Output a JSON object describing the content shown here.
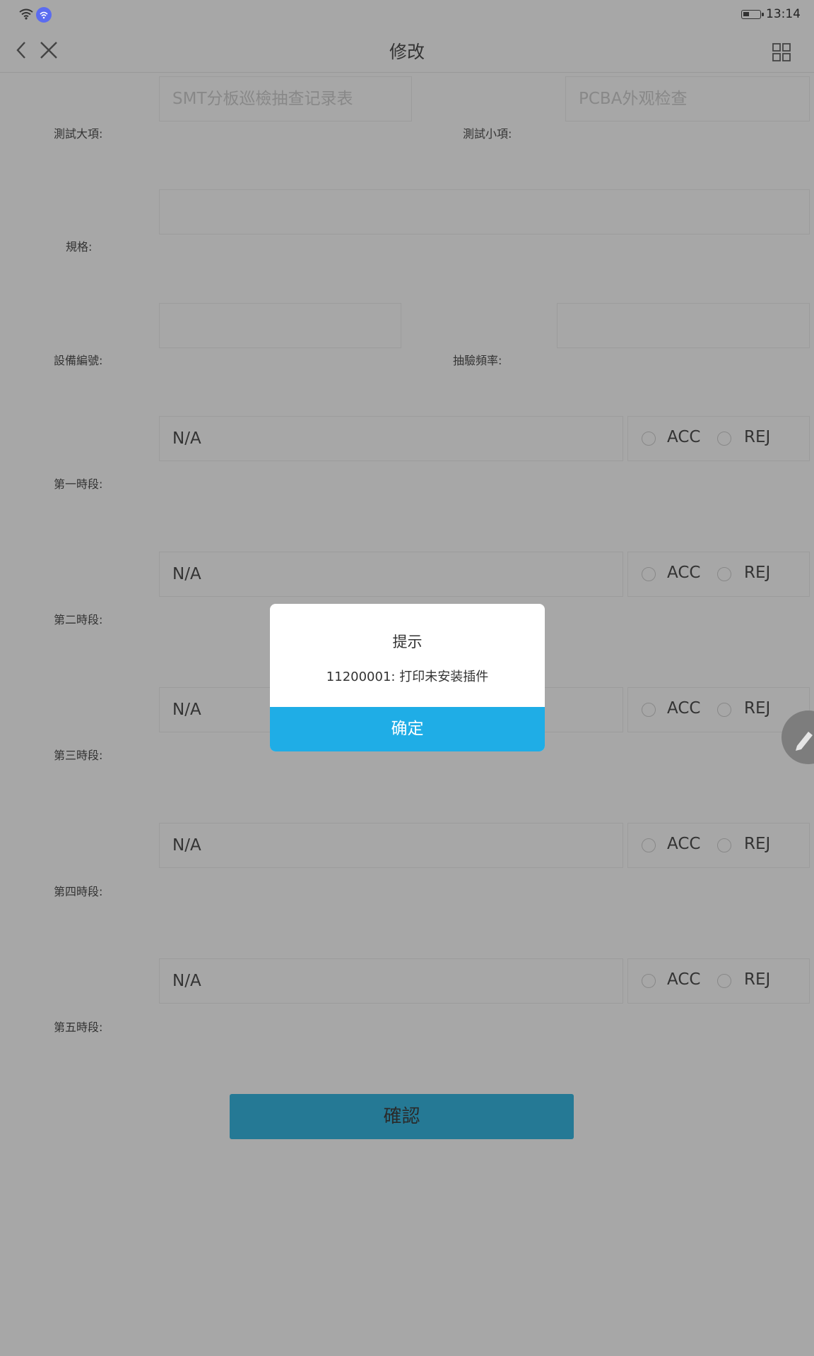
{
  "status_bar": {
    "time": "13:14"
  },
  "header": {
    "title": "修改"
  },
  "form": {
    "test_category_label": "測試大項:",
    "test_category_value": "SMT分板巡檢抽查记录表",
    "test_subitem_label": "測試小項:",
    "test_subitem_value": "PCBA外观检查",
    "spec_label": "規格:",
    "spec_value": "",
    "equipment_no_label": "設備編號:",
    "equipment_no_value": "",
    "sampling_freq_label": "抽驗頻率:",
    "sampling_freq_value": "",
    "periods": [
      {
        "label": "第一時段:",
        "value": "N/A",
        "acc": "ACC",
        "rej": "REJ"
      },
      {
        "label": "第二時段:",
        "value": "N/A",
        "acc": "ACC",
        "rej": "REJ"
      },
      {
        "label": "第三時段:",
        "value": "N/A",
        "acc": "ACC",
        "rej": "REJ"
      },
      {
        "label": "第四時段:",
        "value": "N/A",
        "acc": "ACC",
        "rej": "REJ"
      },
      {
        "label": "第五時段:",
        "value": "N/A",
        "acc": "ACC",
        "rej": "REJ"
      }
    ],
    "submit_label": "確認"
  },
  "dialog": {
    "title": "提示",
    "message": "11200001: 打印未安装插件",
    "ok_label": "确定"
  },
  "colors": {
    "dim_background": "#a7a7a7",
    "dialog_button": "#1fade6",
    "submit_button": "#257995"
  }
}
